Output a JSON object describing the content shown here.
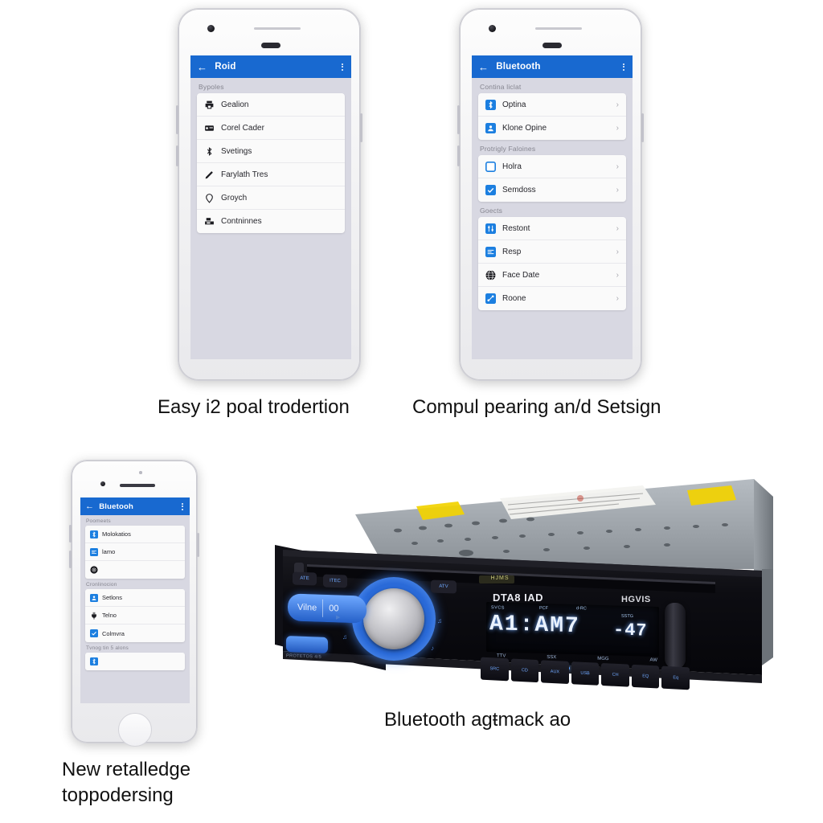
{
  "page": {
    "background_color": "#ffffff",
    "accent_blue": "#1869d0",
    "screen_bg": "#d8d8e2",
    "card_bg": "#fafafa"
  },
  "phones": [
    {
      "id": "phone-android-left",
      "style": "android",
      "appbar": {
        "title": "Roid",
        "back_icon": "back-arrow-icon",
        "overflow_icon": "kebab-menu-icon"
      },
      "sections": [
        {
          "header": "Bypoles",
          "items": [
            {
              "label": "Gealion",
              "icon": "printer-icon",
              "chevron": false
            },
            {
              "label": "Corel Cader",
              "icon": "card-icon",
              "chevron": false
            },
            {
              "label": "Svetings",
              "icon": "bluetooth-icon",
              "chevron": false
            },
            {
              "label": "Farylath Tres",
              "icon": "pencil-icon",
              "chevron": false
            },
            {
              "label": "Groych",
              "icon": "location-pin-icon",
              "chevron": false
            },
            {
              "label": "Contninnes",
              "icon": "scanner-icon",
              "chevron": false
            }
          ]
        }
      ]
    },
    {
      "id": "phone-android-right",
      "style": "android",
      "appbar": {
        "title": "Bluetooth",
        "back_icon": "back-arrow-icon",
        "overflow_icon": "kebab-menu-icon"
      },
      "sections": [
        {
          "header": "Contina liclat",
          "items": [
            {
              "label": "Optina",
              "icon": "bluetooth-tile-icon",
              "chevron": true
            },
            {
              "label": "Klone Opine",
              "icon": "person-tile-icon",
              "chevron": true
            }
          ]
        },
        {
          "header": "Protrigly Faloines",
          "items": [
            {
              "label": "Holra",
              "icon": "square-outline-icon",
              "chevron": true
            },
            {
              "label": "Semdoss",
              "icon": "checkbox-icon",
              "chevron": true
            }
          ]
        },
        {
          "header": "Goects",
          "items": [
            {
              "label": "Restont",
              "icon": "sliders-tile-icon",
              "chevron": true
            },
            {
              "label": "Resp",
              "icon": "list-tile-icon",
              "chevron": true
            },
            {
              "label": "Face Date",
              "icon": "globe-dark-icon",
              "chevron": true
            },
            {
              "label": "Roone",
              "icon": "share-tile-icon",
              "chevron": true
            }
          ]
        }
      ]
    },
    {
      "id": "phone-iphone-bottom",
      "style": "iphone",
      "appbar": {
        "title": "Bluetooh",
        "back_icon": "back-arrow-icon",
        "overflow_icon": "kebab-menu-icon"
      },
      "sections": [
        {
          "header": "Poomeets",
          "items": [
            {
              "label": "Molokatios",
              "icon": "bluetooth-tile-icon",
              "chevron": false
            },
            {
              "label": "lamo",
              "icon": "list-tile-icon",
              "chevron": false
            },
            {
              "label": "",
              "icon": "globe-dark-icon",
              "chevron": false
            }
          ]
        },
        {
          "header": "Cronlinocion",
          "items": [
            {
              "label": "Setlons",
              "icon": "person-tile-icon",
              "chevron": false
            },
            {
              "label": "Telno",
              "icon": "plug-icon",
              "chevron": false
            },
            {
              "label": "Colmvra",
              "icon": "checkbox-icon",
              "chevron": false
            }
          ]
        },
        {
          "header": "Tvnog tin 5 alons",
          "items": [
            {
              "label": "",
              "icon": "bluetooth-tile-icon",
              "chevron": false
            }
          ]
        }
      ]
    }
  ],
  "captions": [
    {
      "id": "caption-left-top",
      "text": "Easy i2 poal trodertion"
    },
    {
      "id": "caption-right-top",
      "text": "Compul pearing an/d Setsign"
    },
    {
      "id": "caption-stereo",
      "text": "Bluetooth agŧmack ao"
    },
    {
      "id": "caption-bottom-left",
      "line1": "New retalledge",
      "line2": "toppodersing"
    }
  ],
  "stereo": {
    "brand_left": "DTA8 IAD",
    "brand_right": "HGVIS",
    "display_main": "A1:AM7",
    "display_right": "-47",
    "display_small_labels": [
      "SVCS",
      "PCF",
      "d-RC",
      "SSTG"
    ],
    "indicator_labels": [
      "TTV",
      "SSX",
      "MGG",
      "AW"
    ],
    "volume_button": "Vilne",
    "volume_value": "00",
    "top_label_small": "HJMS",
    "label_left_small": "ATE",
    "label_left_small2": "ITEC",
    "label_right_small": "ATV",
    "bottom_left_text": "PROTETOS 4/5",
    "bottom_buttons": [
      "SRC",
      "CD",
      "AUX",
      "USB",
      "CH",
      "EQ",
      "Eq"
    ],
    "led_count": 3,
    "chassis_color": "#9aa0a6",
    "face_color": "#0c0c10",
    "accent_blue": "#2b6bd8",
    "display_glow": "#cfe3ff"
  }
}
